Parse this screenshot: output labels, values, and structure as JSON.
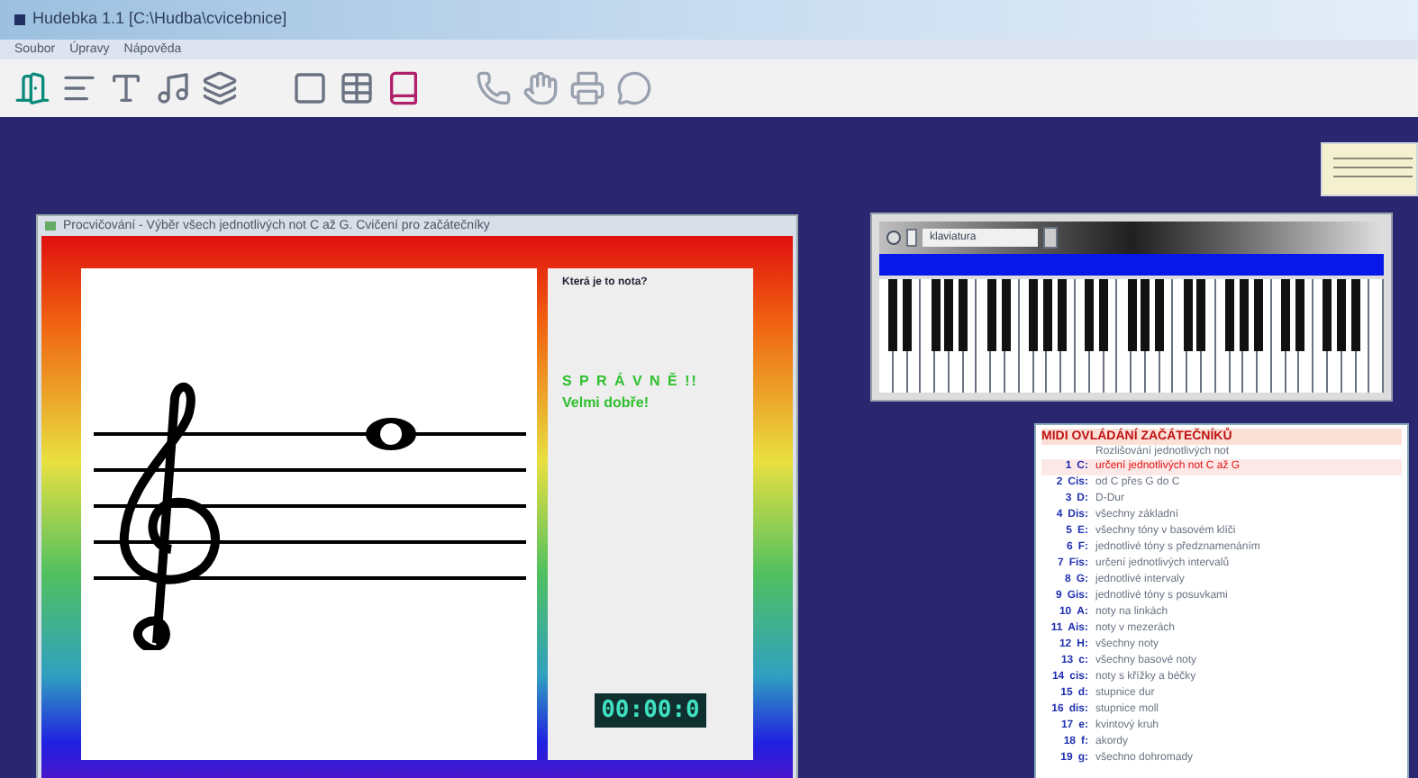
{
  "window": {
    "title": "Hudebka 1.1 [C:\\Hudba\\cvicebnice]"
  },
  "menu": [
    "Soubor",
    "Úpravy",
    "Nápověda"
  ],
  "practice": {
    "title": "Procvičování - Výběr všech jednotlivých not C až G. Cvičení pro začátečníky",
    "question": "Která je to nota?",
    "result": "S P R Á V N Ě !!",
    "praise": "Velmi dobře!",
    "timer": "00:00:0"
  },
  "piano": {
    "field": "klaviatura"
  },
  "lessons": {
    "title": "MIDI OVLÁDÁNÍ ZAČÁTEČNÍKŮ",
    "subtitle": "Rozlišování jednotlivých not",
    "items": [
      {
        "num": "1",
        "note": "C:",
        "text": "určení jednotlivých not C až G",
        "selected": true
      },
      {
        "num": "2",
        "note": "Cis:",
        "text": "od C přes G do C",
        "selected": false
      },
      {
        "num": "3",
        "note": "D:",
        "text": "D-Dur",
        "selected": false
      },
      {
        "num": "4",
        "note": "Dis:",
        "text": "všechny základní",
        "selected": false
      },
      {
        "num": "5",
        "note": "E:",
        "text": "všechny tóny v basovém klíči",
        "selected": false
      },
      {
        "num": "6",
        "note": "F:",
        "text": "jednotlivé tóny s předznamenáním",
        "selected": false
      },
      {
        "num": "7",
        "note": "Fis:",
        "text": "určení jednotlivých intervalů",
        "selected": false
      },
      {
        "num": "8",
        "note": "G:",
        "text": "jednotlivé intervaly",
        "selected": false
      },
      {
        "num": "9",
        "note": "Gis:",
        "text": "jednotlivé tóny s posuvkami",
        "selected": false
      },
      {
        "num": "10",
        "note": "A:",
        "text": "noty na linkách",
        "selected": false
      },
      {
        "num": "11",
        "note": "Ais:",
        "text": "noty v mezerách",
        "selected": false
      },
      {
        "num": "12",
        "note": "H:",
        "text": "všechny noty",
        "selected": false
      },
      {
        "num": "13",
        "note": "c:",
        "text": "všechny basové noty",
        "selected": false
      },
      {
        "num": "14",
        "note": "cis:",
        "text": "noty s křížky a béčky",
        "selected": false
      },
      {
        "num": "15",
        "note": "d:",
        "text": "stupnice dur",
        "selected": false
      },
      {
        "num": "16",
        "note": "dis:",
        "text": "stupnice moll",
        "selected": false
      },
      {
        "num": "17",
        "note": "e:",
        "text": "kvintový kruh",
        "selected": false
      },
      {
        "num": "18",
        "note": "f:",
        "text": "akordy",
        "selected": false
      },
      {
        "num": "19",
        "note": "g:",
        "text": "všechno dohromady",
        "selected": false
      }
    ]
  }
}
